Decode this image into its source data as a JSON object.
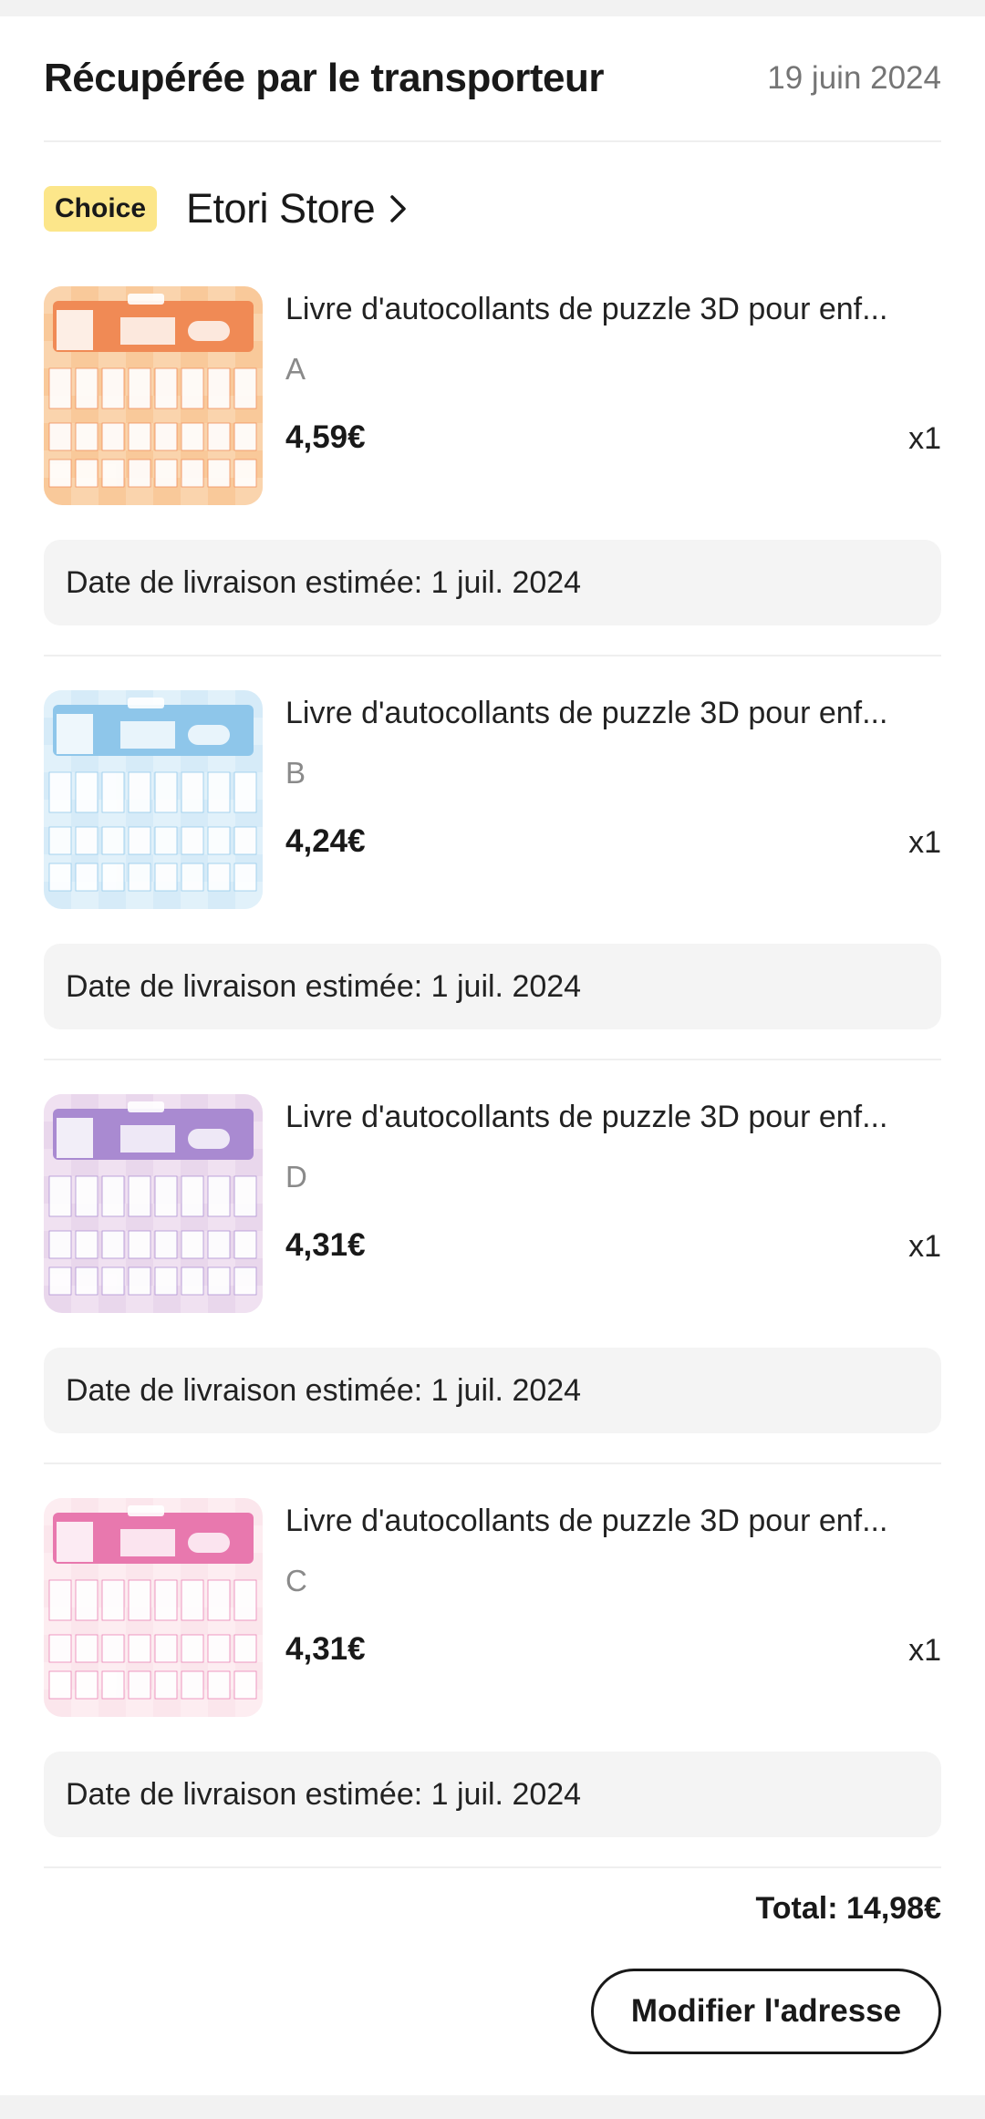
{
  "order": {
    "status": "Récupérée par le transporteur",
    "date": "19 juin 2024"
  },
  "store": {
    "badge": "Choice",
    "name": "Etori Store",
    "badge_color": "#fce68a"
  },
  "items": [
    {
      "title": "Livre d'autocollants de puzzle 3D pour enf...",
      "variant": "A",
      "price": "4,59€",
      "qty": "x1",
      "delivery": "Date de livraison estimée: 1 juil. 2024",
      "image_theme": "orange",
      "image_colors": {
        "bg": "#f9c99a",
        "band": "#f08a55",
        "check": "#fbd9b5"
      }
    },
    {
      "title": "Livre d'autocollants de puzzle 3D pour enf...",
      "variant": "B",
      "price": "4,24€",
      "qty": "x1",
      "delivery": "Date de livraison estimée: 1 juil. 2024",
      "image_theme": "blue",
      "image_colors": {
        "bg": "#d6ebf8",
        "band": "#8ec6ea",
        "check": "#e6f3fb"
      }
    },
    {
      "title": "Livre d'autocollants de puzzle 3D pour enf...",
      "variant": "D",
      "price": "4,31€",
      "qty": "x1",
      "delivery": "Date de livraison estimée: 1 juil. 2024",
      "image_theme": "purple",
      "image_colors": {
        "bg": "#e9d7ec",
        "band": "#a98ad1",
        "check": "#f2e6f3"
      }
    },
    {
      "title": "Livre d'autocollants de puzzle 3D pour enf...",
      "variant": "C",
      "price": "4,31€",
      "qty": "x1",
      "delivery": "Date de livraison estimée: 1 juil. 2024",
      "image_theme": "pink",
      "image_colors": {
        "bg": "#fbe6ec",
        "band": "#e878ae",
        "check": "#fdf0f4"
      }
    }
  ],
  "footer": {
    "total": "Total: 14,98€",
    "modify_button": "Modifier l'adresse"
  }
}
